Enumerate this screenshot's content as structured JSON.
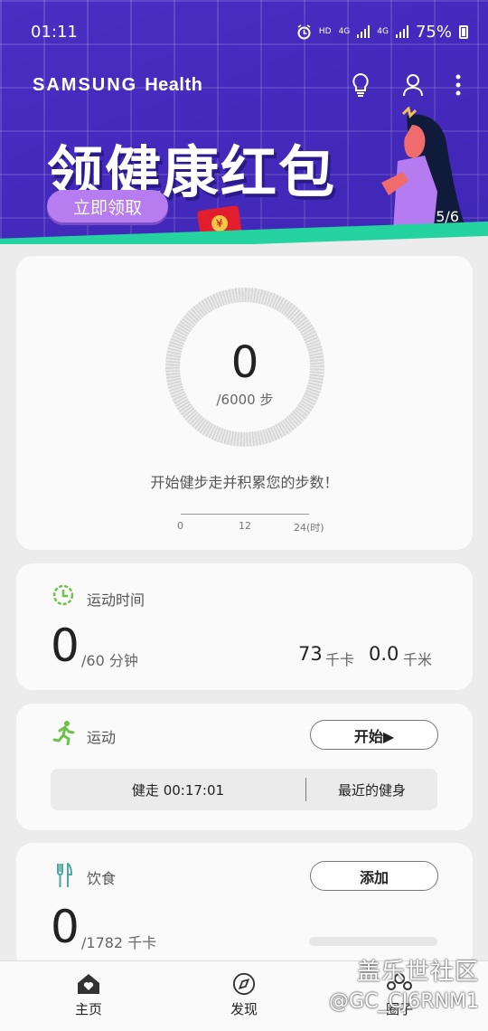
{
  "status_bar": {
    "time": "01:11",
    "hd": "HD",
    "net1": "4G",
    "net2": "4G",
    "battery": "75%"
  },
  "header": {
    "brand": "SAMSUNG",
    "brand_suffix": "Health"
  },
  "banner": {
    "title": "领健康红包",
    "button": "立即领取",
    "pager": "5/6"
  },
  "steps_card": {
    "count": "0",
    "goal": "/6000 步",
    "hint": "开始健步走并积累您的步数！",
    "ticks": [
      "0",
      "12",
      "24(时)"
    ]
  },
  "exercise_time_card": {
    "title": "运动时间",
    "value": "0",
    "goal": "/60 分钟",
    "kcal_value": "73",
    "kcal_unit": "千卡",
    "km_value": "0.0",
    "km_unit": "千米"
  },
  "workout_card": {
    "title": "运动",
    "start_button": "开始▶",
    "recent_left": "健走   00:17:01",
    "recent_right": "最近的健身"
  },
  "food_card": {
    "title": "饮食",
    "add_button": "添加",
    "value": "0",
    "goal": "/1782 千卡"
  },
  "bottom_nav": {
    "home": "主页",
    "discover": "发现",
    "together": "圈子"
  },
  "watermark": {
    "line1": "盖乐世社区",
    "line2": "@GC_CJ6RNM1"
  },
  "colors": {
    "banner_bg": "#4a2fc4",
    "accent_green": "#24d3a0",
    "icon_green": "#6cc24a"
  }
}
